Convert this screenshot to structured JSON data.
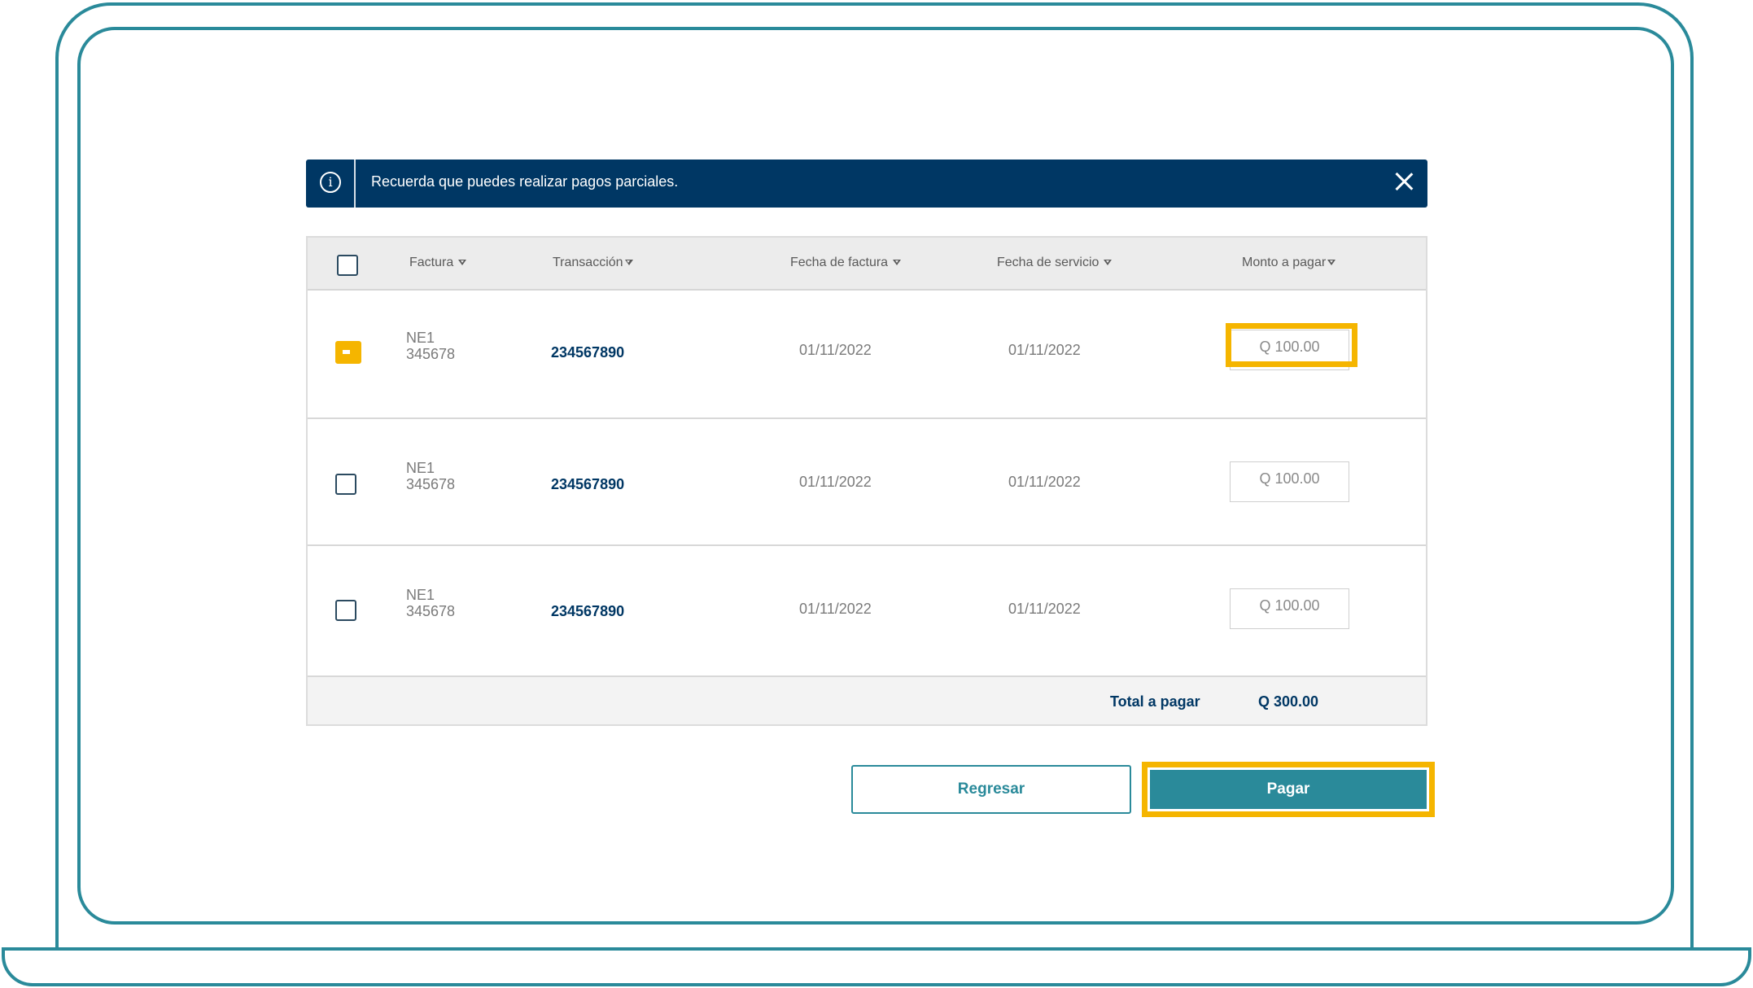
{
  "alert": {
    "message": "Recuerda que puedes realizar pagos parciales.",
    "info_icon": "info-circle-icon",
    "close_icon": "close-icon"
  },
  "table": {
    "headers": {
      "factura": "Factura",
      "transaccion": "Transacción",
      "fecha_factura": "Fecha de factura",
      "fecha_servicio": "Fecha de servicio",
      "monto": "Monto a pagar"
    },
    "rows": [
      {
        "factura_line1": "NE1",
        "factura_line2": "345678",
        "transaccion": "234567890",
        "fecha_factura": "01/11/2022",
        "fecha_servicio": "01/11/2022",
        "monto": "Q 100.00",
        "checked": true
      },
      {
        "factura_line1": "NE1",
        "factura_line2": "345678",
        "transaccion": "234567890",
        "fecha_factura": "01/11/2022",
        "fecha_servicio": "01/11/2022",
        "monto": "Q 100.00",
        "checked": false
      },
      {
        "factura_line1": "NE1",
        "factura_line2": "345678",
        "transaccion": "234567890",
        "fecha_factura": "01/11/2022",
        "fecha_servicio": "01/11/2022",
        "monto": "Q 100.00",
        "checked": false
      }
    ],
    "total_label": "Total a pagar",
    "total_value": "Q 300.00"
  },
  "actions": {
    "back_label": "Regresar",
    "pay_label": "Pagar"
  },
  "colors": {
    "navy": "#003764",
    "teal": "#2a8a9a",
    "highlight": "#f5b500"
  }
}
